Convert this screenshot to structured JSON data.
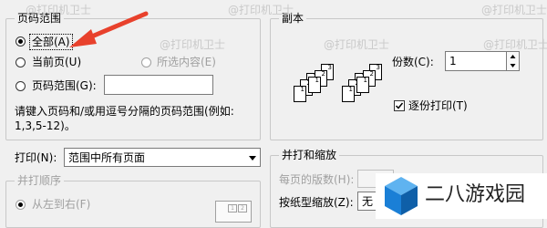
{
  "page_range": {
    "title": "页码范围",
    "all": "全部(A)",
    "current_page": "当前页(U)",
    "selection": "所选内容(E)",
    "pages": "页码范围(G):",
    "pages_value": "",
    "hint_line1": "请键入页码和/或用逗号分隔的页码范围(例如:",
    "hint_line2": "1,3,5-12)。"
  },
  "copies": {
    "title": "副本",
    "count_label": "份数(C):",
    "count_value": "1",
    "collate_label": "逐份打印(T)",
    "collate_checked": true
  },
  "print_what": {
    "label": "打印(N):",
    "value": "范围中所有页面"
  },
  "collate_order": {
    "title": "并打顺序",
    "left_to_right": "从左到右(F)"
  },
  "zoom": {
    "title": "并打和缩放",
    "pages_per_sheet_label": "每页的版数(H):",
    "scale_label": "按纸型缩放(Z):",
    "scale_value": "无"
  },
  "watermark": {
    "text": "@打印机卫士",
    "logo_text": "二八游戏园"
  },
  "colors": {
    "arrow": "#e8412c",
    "logo_blue": "#1a7fd6"
  }
}
